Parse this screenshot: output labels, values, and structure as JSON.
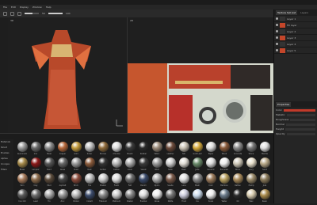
{
  "menu": [
    "File",
    "Edit",
    "Display",
    "Window",
    "Help"
  ],
  "toolbar": {
    "size_value": "50",
    "opacity_value": "100",
    "size_fill": 0.55,
    "opacity_fill": 1.0
  },
  "viewports": {
    "left_label": "3D",
    "right_label": "2D"
  },
  "right_panel": {
    "tabs": [
      "Texture Set List",
      "Layers",
      "Properties"
    ],
    "layers": [
      "Layer 1",
      "Fill layer",
      "Layer 2",
      "Layer 3",
      "Layer 4",
      "Layer 5"
    ],
    "properties_title": "Properties",
    "fields": [
      "Color",
      "Metallic",
      "Roughness",
      "Normal",
      "Height",
      "Opacity"
    ]
  },
  "shelf": {
    "categories": [
      "Materials",
      "Smart",
      "Brushes",
      "Alphas",
      "Grunges",
      "Filters"
    ],
    "materials": [
      {
        "n": "Aluminium",
        "c": "#9a9a9a"
      },
      {
        "n": "Iron",
        "c": "#6a6a6a"
      },
      {
        "n": "Steel",
        "c": "#888"
      },
      {
        "n": "Copper",
        "c": "#b5673a"
      },
      {
        "n": "Gold",
        "c": "#c29a3c"
      },
      {
        "n": "Silver",
        "c": "#bbb"
      },
      {
        "n": "Bronze",
        "c": "#8e6a3a"
      },
      {
        "n": "Chrome",
        "c": "#ddd"
      },
      {
        "n": "Plastic",
        "c": "#3a3a3a"
      },
      {
        "n": "Rubber",
        "c": "#2a2a2a"
      },
      {
        "n": "Fabric",
        "c": "#9b8b7a"
      },
      {
        "n": "Leather",
        "c": "#6b4a3a"
      },
      {
        "n": "Silk",
        "c": "#c9c1b3"
      },
      {
        "n": "Gold Leaf",
        "c": "#d4a93c"
      },
      {
        "n": "Paper",
        "c": "#ddd"
      },
      {
        "n": "Wood",
        "c": "#8a5a3a"
      },
      {
        "n": "Concrete",
        "c": "#888"
      },
      {
        "n": "Stone",
        "c": "#777"
      },
      {
        "n": "Marble",
        "c": "#e0e0e0"
      },
      {
        "n": "Brass",
        "c": "#a68a4a"
      },
      {
        "n": "Lacquer",
        "c": "#8a1818"
      },
      {
        "n": "Paint",
        "c": "#555"
      },
      {
        "n": "Glass",
        "c": "#666"
      },
      {
        "n": "Dust",
        "c": "#9a9a9a"
      },
      {
        "n": "Rust",
        "c": "#8a5a3a"
      },
      {
        "n": "Carbon",
        "c": "#333"
      },
      {
        "n": "Cotton",
        "c": "#b8b8b8"
      },
      {
        "n": "Linen",
        "c": "#aaa"
      },
      {
        "n": "Velvet",
        "c": "#3a3a3a"
      },
      {
        "n": "Wool",
        "c": "#999"
      },
      {
        "n": "Satin",
        "c": "#ccc"
      },
      {
        "n": "Pearl",
        "c": "#e0dcd4"
      },
      {
        "n": "Jade",
        "c": "#6a8a6a"
      },
      {
        "n": "Ceramic",
        "c": "#ddd"
      },
      {
        "n": "Porcelain",
        "c": "#eee"
      },
      {
        "n": "Bone",
        "c": "#cfc8b8"
      },
      {
        "n": "Ivory",
        "c": "#e8e0cc"
      },
      {
        "n": "Sand",
        "c": "#b8a888"
      },
      {
        "n": "Skin",
        "c": "#a67a5a"
      },
      {
        "n": "Clay",
        "c": "#8a6a4a"
      },
      {
        "n": "Mud",
        "c": "#5a4a3a"
      },
      {
        "n": "Asphalt",
        "c": "#444"
      },
      {
        "n": "Brick",
        "c": "#8a4a3a"
      },
      {
        "n": "Tile",
        "c": "#bbb"
      },
      {
        "n": "Plaster",
        "c": "#ccc"
      },
      {
        "n": "Foam",
        "c": "#ddd"
      },
      {
        "n": "Felt",
        "c": "#6a6a6a"
      },
      {
        "n": "Denim",
        "c": "#3a4a6a"
      },
      {
        "n": "Nylon",
        "c": "#aaa"
      },
      {
        "n": "Suede",
        "c": "#7a5a4a"
      },
      {
        "n": "Lace",
        "c": "#e0e0e0"
      },
      {
        "n": "Mesh",
        "c": "#888"
      },
      {
        "n": "Cork",
        "c": "#9a7a5a"
      },
      {
        "n": "Bamboo",
        "c": "#b8a060"
      },
      {
        "n": "Rattan",
        "c": "#a88a5a"
      },
      {
        "n": "Hemp",
        "c": "#9a8a6a"
      },
      {
        "n": "Jute",
        "c": "#8a7a5a"
      },
      {
        "n": "Iron Old",
        "c": "#5a5a5a"
      },
      {
        "n": "Lead",
        "c": "#6a6a6a"
      },
      {
        "n": "Tin",
        "c": "#aaa"
      },
      {
        "n": "Zinc",
        "c": "#999"
      },
      {
        "n": "Nickel",
        "c": "#bbb"
      },
      {
        "n": "Cobalt",
        "c": "#3a4a6a"
      },
      {
        "n": "Titanium",
        "c": "#8a8a8a"
      },
      {
        "n": "Platinum",
        "c": "#ccc"
      },
      {
        "n": "Pewter",
        "c": "#888"
      },
      {
        "n": "Enamel",
        "c": "#ddd"
      },
      {
        "n": "Gloss",
        "c": "#eee"
      },
      {
        "n": "Matte",
        "c": "#777"
      },
      {
        "n": "Frost",
        "c": "#ccd"
      },
      {
        "n": "Ice",
        "c": "#cde"
      },
      {
        "n": "Snow",
        "c": "#eee"
      },
      {
        "n": "Water",
        "c": "#6a7a8a"
      },
      {
        "n": "Oil",
        "c": "#2a2a2a"
      },
      {
        "n": "Wax",
        "c": "#d8ccb0"
      },
      {
        "n": "Resin",
        "c": "#a88a4a"
      }
    ]
  }
}
